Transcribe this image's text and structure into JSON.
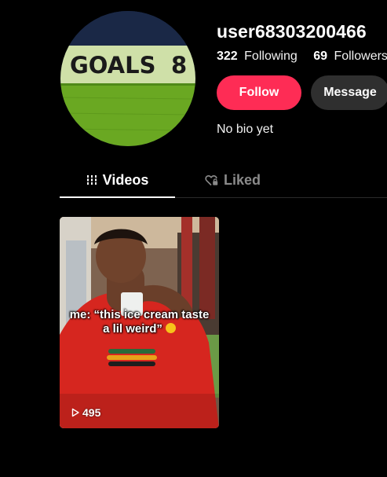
{
  "profile": {
    "username": "user68303200466",
    "avatar_text": {
      "word": "GOALS",
      "number": "8"
    },
    "stats": [
      {
        "value": "322",
        "label": "Following"
      },
      {
        "value": "69",
        "label": "Followers"
      }
    ],
    "bio": "No bio yet"
  },
  "actions": {
    "follow_label": "Follow",
    "message_label": "Message"
  },
  "tabs": [
    {
      "label": "Videos",
      "icon": "grid-icon",
      "active": true
    },
    {
      "label": "Liked",
      "icon": "heart-lock-icon",
      "active": false
    }
  ],
  "videos": [
    {
      "caption_line1": "me: “this ice cream taste",
      "caption_line2": "a lil weird”",
      "caption_emoji": "thinking-face-icon",
      "play_count": "495"
    }
  ],
  "colors": {
    "background": "#000000",
    "follow_button": "#fe2c55",
    "message_button": "#2f2f2f",
    "inactive_tab": "#8a8a8a"
  }
}
